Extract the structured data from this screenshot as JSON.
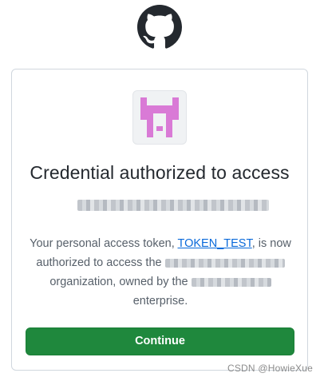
{
  "header": {
    "logo_icon": "github-mark-icon"
  },
  "card": {
    "avatar_icon": "organization-identicon",
    "avatar_color": "#d97ad6",
    "title": "Credential authorized to access",
    "description": {
      "prefix": "Your personal access token, ",
      "token_link": "TOKEN_TEST",
      "after_token": ", is now",
      "line2": "authorized to access the",
      "line3": "organization, owned by the",
      "line4": "enterprise."
    },
    "continue_label": "Continue"
  },
  "colors": {
    "primary_button": "#1f883d",
    "link": "#0969da",
    "muted_text": "#57606a"
  },
  "watermark": {
    "text": "CSDN @HowieXue"
  }
}
